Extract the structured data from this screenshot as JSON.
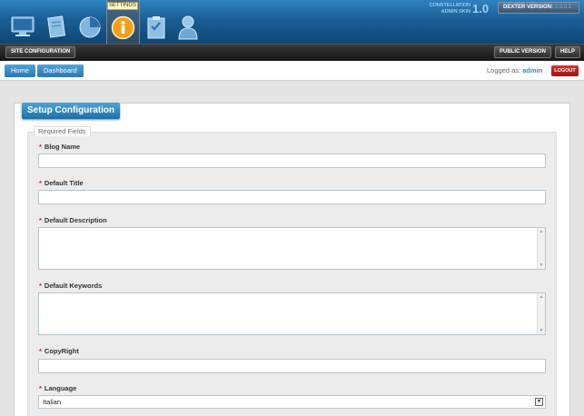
{
  "header": {
    "settings_tab_label": "SETTINGS",
    "skin_line1": "CONSTELLATION",
    "skin_line2": "ADMIN SKIN",
    "skin_version": "1.0",
    "dexter_label": "DEXTER VERSION:",
    "dexter_version": "2.0.0.1",
    "nav_icons": [
      "monitor-icon",
      "notepad-icon",
      "pie-chart-icon",
      "info-icon",
      "clipboard-icon",
      "user-icon"
    ]
  },
  "toolbar": {
    "site_configuration": "SITE CONFIGURATION",
    "public_version": "PUBLIC VERSION",
    "help": "HELP"
  },
  "breadcrumb": {
    "home": "Home",
    "dashboard": "Dashboard"
  },
  "session": {
    "logged_as_label": "Logged as:",
    "username": "admin",
    "logout": "LOGOUT"
  },
  "main": {
    "title": "Setup Configuration",
    "legend": "Required Fields",
    "required_marker": "*",
    "fields": [
      {
        "label": "Blog Name",
        "value": ""
      },
      {
        "label": "Default Title",
        "value": ""
      },
      {
        "label": "Default Description",
        "value": ""
      },
      {
        "label": "Default Keywords",
        "value": ""
      },
      {
        "label": "CopyRight",
        "value": ""
      },
      {
        "label": "Language",
        "value": "Italian"
      }
    ]
  },
  "colors": {
    "accent": "#2b79b5",
    "header": "#1b5e95",
    "logout": "#c8102e"
  }
}
